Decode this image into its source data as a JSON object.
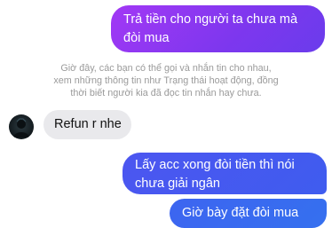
{
  "messages": {
    "outgoing_1": [
      "Trả tiền cho người ta chưa mà",
      "đòi mua"
    ],
    "notice": [
      "Giờ đây, các bạn có thể gọi và nhắn tin cho nhau,",
      "xem những thông tin như Trạng thái hoạt động, đồng",
      "thời biết người kia đã đọc tin nhắn hay chưa."
    ],
    "incoming_1": "Refun r nhe",
    "outgoing_2": [
      "Lấy acc xong đòi tiền thì nói",
      "chưa giải ngân"
    ],
    "outgoing_3": "Giờ bày đặt đòi mua"
  },
  "avatar_icon": "contact-avatar-icon",
  "colors": {
    "outgoing_gradient_start": "#a238f5",
    "outgoing_gradient_end": "#3570ef",
    "incoming_bubble": "#e9e9ec",
    "notice_text": "#9a9a9a"
  }
}
